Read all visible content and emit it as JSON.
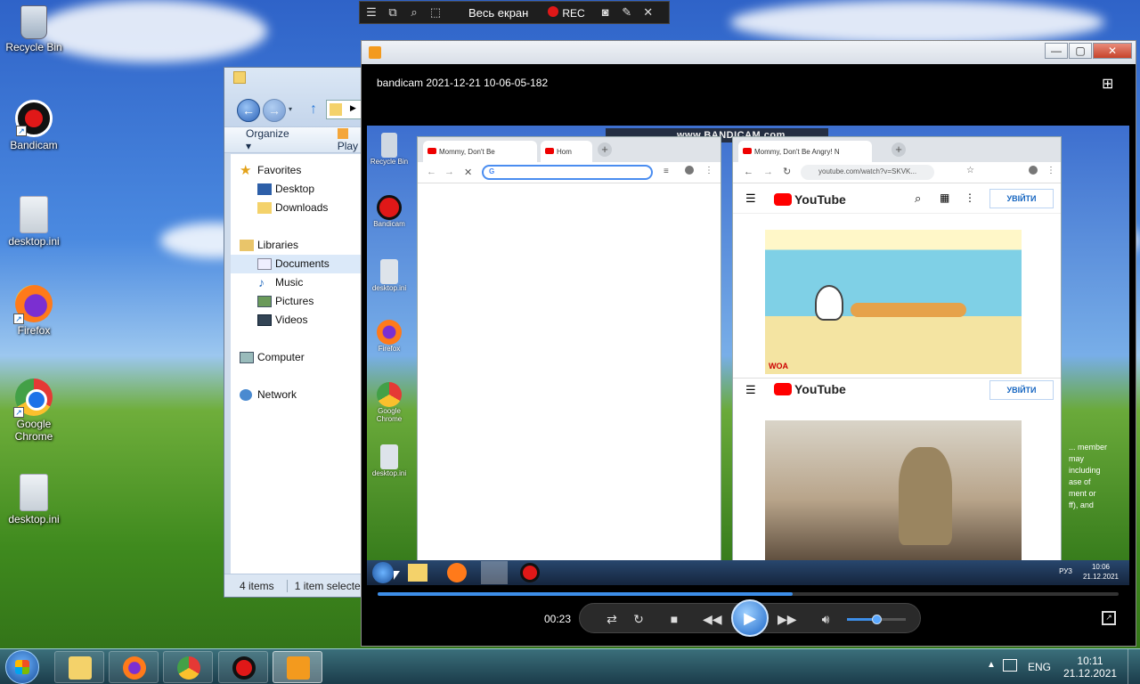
{
  "desktop": {
    "icons": [
      {
        "label": "Recycle Bin",
        "icon": "recycle-bin-icon"
      },
      {
        "label": "Bandicam",
        "icon": "bandicam-icon"
      },
      {
        "label": "desktop.ini",
        "icon": "settings-file-icon"
      },
      {
        "label": "Firefox",
        "icon": "firefox-icon"
      },
      {
        "label": "Google Chrome",
        "icon": "chrome-icon"
      },
      {
        "label": "desktop.ini",
        "icon": "settings-file-icon"
      }
    ]
  },
  "recorder_toolbar": {
    "mode_label": "Весь екран",
    "rec_label": "REC"
  },
  "explorer": {
    "organize_label": "Organize ▾",
    "play_label": "Play",
    "nav": [
      {
        "label": "Favorites",
        "level": 0,
        "icon": "star-icon"
      },
      {
        "label": "Desktop",
        "level": 1,
        "icon": "desktop-folder-icon"
      },
      {
        "label": "Downloads",
        "level": 1,
        "icon": "downloads-folder-icon"
      },
      {
        "label": "Libraries",
        "level": 0,
        "icon": "libraries-icon"
      },
      {
        "label": "Documents",
        "level": 1,
        "icon": "documents-icon"
      },
      {
        "label": "Music",
        "level": 1,
        "icon": "music-icon"
      },
      {
        "label": "Pictures",
        "level": 1,
        "icon": "pictures-icon"
      },
      {
        "label": "Videos",
        "level": 1,
        "icon": "videos-icon"
      },
      {
        "label": "Computer",
        "level": 0,
        "icon": "computer-icon"
      },
      {
        "label": "Network",
        "level": 0,
        "icon": "network-icon"
      }
    ],
    "status_items": "4 items",
    "status_selected": "1 item selected"
  },
  "player": {
    "filename": "bandicam 2021-12-21 10-06-05-182",
    "current_time": "00:23",
    "progress": 0.56,
    "volume": 0.5
  },
  "video_frame": {
    "watermark": "www.BANDICAM.com",
    "mini_icons": [
      "Recycle Bin",
      "Bandicam",
      "desktop.ini",
      "Firefox",
      "Google Chrome",
      "desktop.ini"
    ],
    "left_browser": {
      "tab1": "Mommy, Don't Be",
      "tab2": "Hom"
    },
    "right_browser": {
      "tab": "Mommy, Don't Be Angry! N",
      "url": "youtube.com/watch?v=SKVK...",
      "youtube_label": "YouTube",
      "signin_label": "УВІЙТИ",
      "channel_tag": "WOA"
    },
    "overlay_text": "... member may\nincluding\nase of\nment or\nff), and",
    "mini_tray": {
      "lang": "РУЗ",
      "time": "10:06",
      "date": "21.12.2021"
    }
  },
  "taskbar": {
    "lang": "ENG",
    "time": "10:11",
    "date": "21.12.2021"
  }
}
